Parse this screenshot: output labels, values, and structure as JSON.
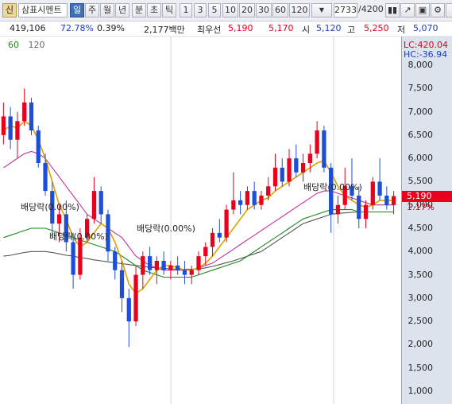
{
  "toolbar": {
    "logo": "신",
    "stock_name": "삼표시멘트",
    "period_buttons": [
      "일",
      "주",
      "월",
      "년",
      "분",
      "초",
      "틱"
    ],
    "minute_buttons": [
      "1",
      "3",
      "5",
      "10",
      "20",
      "30",
      "60",
      "120"
    ],
    "count_field": "2733",
    "count_total": "/4200",
    "active_period": "일"
  },
  "infobar": {
    "volume": "419,106",
    "vol_pct": "72.78%",
    "turnover_pct": "0.39%",
    "amount": "2,177백만",
    "priority_label": "최우선",
    "ask": "5,190",
    "bid": "5,170",
    "open_label": "시",
    "open": "5,120",
    "high_label": "고",
    "high": "5,250",
    "low_label": "저",
    "low": "5,070"
  },
  "ma_legend": [
    "60",
    "120"
  ],
  "right_axis": {
    "lc": "LC:420.04",
    "hc": "HC:-36.94",
    "ticks": [
      "8,000",
      "7,500",
      "7,000",
      "6,500",
      "6,000",
      "5,500",
      "5,000",
      "4,500",
      "4,000",
      "3,500",
      "3,000",
      "2,500",
      "2,000",
      "1,500",
      "1,000"
    ],
    "current_price": "5,190",
    "change_pct": "1.17%"
  },
  "annotations": [
    "배당락(0.00%)",
    "배당락(0.00%)",
    "배당락(0.00%)",
    "배당락(0.00%)"
  ],
  "colors": {
    "up": "#e8001c",
    "down": "#1e4ed8",
    "ma5": "#e0a000",
    "ma20": "#c0309a",
    "ma60": "#1a8a1a",
    "ma120": "#555555"
  },
  "chart_data": {
    "type": "candlestick",
    "ylim": [
      900,
      8300
    ],
    "series": [
      {
        "o": 6500,
        "h": 7200,
        "l": 6300,
        "c": 6900
      },
      {
        "o": 6900,
        "h": 7100,
        "l": 6200,
        "c": 6400
      },
      {
        "o": 6400,
        "h": 7000,
        "l": 6000,
        "c": 6800
      },
      {
        "o": 6800,
        "h": 7500,
        "l": 6700,
        "c": 7200
      },
      {
        "o": 7200,
        "h": 7300,
        "l": 6500,
        "c": 6600
      },
      {
        "o": 6600,
        "h": 6700,
        "l": 5800,
        "c": 5900
      },
      {
        "o": 5900,
        "h": 6100,
        "l": 5200,
        "c": 5300
      },
      {
        "o": 5300,
        "h": 5500,
        "l": 4300,
        "c": 4600
      },
      {
        "o": 4600,
        "h": 5000,
        "l": 4200,
        "c": 4800
      },
      {
        "o": 4800,
        "h": 5100,
        "l": 4000,
        "c": 4200
      },
      {
        "o": 4200,
        "h": 4400,
        "l": 3200,
        "c": 3500
      },
      {
        "o": 3500,
        "h": 4500,
        "l": 3400,
        "c": 4300
      },
      {
        "o": 4300,
        "h": 4800,
        "l": 4200,
        "c": 4700
      },
      {
        "o": 4700,
        "h": 5600,
        "l": 4600,
        "c": 5300
      },
      {
        "o": 5300,
        "h": 5400,
        "l": 4600,
        "c": 4800
      },
      {
        "o": 4800,
        "h": 4900,
        "l": 3800,
        "c": 4000
      },
      {
        "o": 4000,
        "h": 4100,
        "l": 3400,
        "c": 3600
      },
      {
        "o": 3600,
        "h": 3800,
        "l": 2700,
        "c": 3000
      },
      {
        "o": 3000,
        "h": 3200,
        "l": 1950,
        "c": 2500
      },
      {
        "o": 2500,
        "h": 3700,
        "l": 2400,
        "c": 3500
      },
      {
        "o": 3500,
        "h": 4000,
        "l": 3200,
        "c": 3900
      },
      {
        "o": 3900,
        "h": 4100,
        "l": 3500,
        "c": 3600
      },
      {
        "o": 3600,
        "h": 3900,
        "l": 3300,
        "c": 3800
      },
      {
        "o": 3800,
        "h": 4000,
        "l": 3500,
        "c": 3600
      },
      {
        "o": 3600,
        "h": 3800,
        "l": 3400,
        "c": 3700
      },
      {
        "o": 3700,
        "h": 3900,
        "l": 3500,
        "c": 3600
      },
      {
        "o": 3600,
        "h": 3800,
        "l": 3300,
        "c": 3500
      },
      {
        "o": 3500,
        "h": 3700,
        "l": 3300,
        "c": 3600
      },
      {
        "o": 3600,
        "h": 4000,
        "l": 3500,
        "c": 3900
      },
      {
        "o": 3900,
        "h": 4200,
        "l": 3700,
        "c": 4100
      },
      {
        "o": 4100,
        "h": 4500,
        "l": 3900,
        "c": 4400
      },
      {
        "o": 4400,
        "h": 4700,
        "l": 4200,
        "c": 4300
      },
      {
        "o": 4300,
        "h": 5000,
        "l": 4200,
        "c": 4900
      },
      {
        "o": 4900,
        "h": 5700,
        "l": 4800,
        "c": 5100
      },
      {
        "o": 5100,
        "h": 5300,
        "l": 4800,
        "c": 5000
      },
      {
        "o": 5000,
        "h": 5400,
        "l": 4900,
        "c": 5300
      },
      {
        "o": 5300,
        "h": 5500,
        "l": 4900,
        "c": 5000
      },
      {
        "o": 5000,
        "h": 5300,
        "l": 4900,
        "c": 5200
      },
      {
        "o": 5200,
        "h": 5600,
        "l": 5100,
        "c": 5400
      },
      {
        "o": 5400,
        "h": 6100,
        "l": 5300,
        "c": 5800
      },
      {
        "o": 5800,
        "h": 6000,
        "l": 5400,
        "c": 5500
      },
      {
        "o": 5500,
        "h": 6200,
        "l": 5400,
        "c": 6000
      },
      {
        "o": 6000,
        "h": 6300,
        "l": 5600,
        "c": 5700
      },
      {
        "o": 5700,
        "h": 6100,
        "l": 5500,
        "c": 5900
      },
      {
        "o": 5900,
        "h": 6300,
        "l": 5700,
        "c": 6100
      },
      {
        "o": 6100,
        "h": 6800,
        "l": 6000,
        "c": 6600
      },
      {
        "o": 6600,
        "h": 6700,
        "l": 5700,
        "c": 5800
      },
      {
        "o": 5800,
        "h": 5900,
        "l": 4400,
        "c": 4800
      },
      {
        "o": 4800,
        "h": 5200,
        "l": 4600,
        "c": 5000
      },
      {
        "o": 5000,
        "h": 5800,
        "l": 4900,
        "c": 5400
      },
      {
        "o": 5400,
        "h": 6000,
        "l": 5100,
        "c": 5200
      },
      {
        "o": 5200,
        "h": 5400,
        "l": 4500,
        "c": 4700
      },
      {
        "o": 4700,
        "h": 5100,
        "l": 4500,
        "c": 5000
      },
      {
        "o": 5000,
        "h": 5600,
        "l": 4900,
        "c": 5500
      },
      {
        "o": 5500,
        "h": 6000,
        "l": 5100,
        "c": 5200
      },
      {
        "o": 5200,
        "h": 5400,
        "l": 4900,
        "c": 5000
      },
      {
        "o": 5000,
        "h": 5300,
        "l": 4800,
        "c": 5190
      }
    ],
    "ma": {
      "ma5": [
        6600,
        6700,
        6650,
        6800,
        6700,
        6400,
        6000,
        5500,
        5000,
        4700,
        4300,
        4100,
        4200,
        4400,
        4600,
        4500,
        4200,
        3800,
        3300,
        3100,
        3200,
        3400,
        3600,
        3700,
        3700,
        3650,
        3600,
        3600,
        3650,
        3750,
        3900,
        4100,
        4300,
        4500,
        4700,
        4900,
        5000,
        5100,
        5150,
        5300,
        5400,
        5500,
        5600,
        5700,
        5800,
        5900,
        5950,
        5700,
        5400,
        5200,
        5100,
        5000,
        4950,
        5000,
        5100,
        5100,
        5100
      ],
      "ma20": [
        5800,
        5900,
        6000,
        6100,
        6150,
        6100,
        6000,
        5800,
        5600,
        5400,
        5200,
        5000,
        4800,
        4700,
        4600,
        4500,
        4400,
        4300,
        4100,
        3900,
        3800,
        3700,
        3650,
        3600,
        3600,
        3600,
        3600,
        3600,
        3650,
        3700,
        3750,
        3850,
        3950,
        4050,
        4150,
        4250,
        4350,
        4450,
        4550,
        4650,
        4750,
        4850,
        4950,
        5050,
        5150,
        5250,
        5300,
        5300,
        5250,
        5200,
        5150,
        5100,
        5050,
        5000,
        5000,
        5000,
        5000
      ],
      "ma60": [
        4300,
        4350,
        4400,
        4450,
        4500,
        4500,
        4500,
        4450,
        4400,
        4350,
        4300,
        4250,
        4200,
        4150,
        4100,
        4050,
        4000,
        3900,
        3800,
        3700,
        3600,
        3550,
        3500,
        3450,
        3450,
        3450,
        3450,
        3450,
        3500,
        3550,
        3600,
        3650,
        3700,
        3750,
        3800,
        3900,
        4000,
        4100,
        4200,
        4300,
        4400,
        4500,
        4600,
        4700,
        4750,
        4800,
        4850,
        4900,
        4900,
        4900,
        4900,
        4850,
        4850,
        4850,
        4850,
        4850,
        4850
      ],
      "ma120": [
        3900,
        3920,
        3950,
        3980,
        4000,
        4000,
        4000,
        3980,
        3950,
        3920,
        3900,
        3870,
        3850,
        3820,
        3800,
        3780,
        3760,
        3740,
        3720,
        3700,
        3680,
        3660,
        3650,
        3640,
        3630,
        3620,
        3620,
        3620,
        3630,
        3650,
        3680,
        3720,
        3760,
        3800,
        3850,
        3900,
        3950,
        4000,
        4100,
        4200,
        4300,
        4400,
        4500,
        4600,
        4650,
        4700,
        4750,
        4800,
        4820,
        4830,
        4840,
        4850,
        4850,
        4850,
        4850,
        4850,
        4850
      ]
    }
  }
}
